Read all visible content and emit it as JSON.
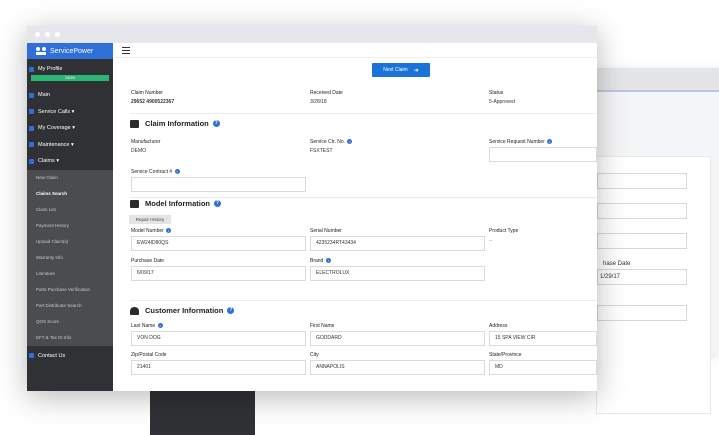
{
  "app": {
    "brand": "ServicePower"
  },
  "sidebar": {
    "items": [
      {
        "label": "My Profile"
      },
      {
        "label": "Main"
      },
      {
        "label": "Service Calls ▾"
      },
      {
        "label": "My Coverage ▾"
      },
      {
        "label": "Maintenance ▾"
      },
      {
        "label": "Claims ▾"
      }
    ],
    "profile_progress": "100%",
    "claims_submenu": [
      "New Claim",
      "Claims Search",
      "Claim List",
      "Payment History",
      "Upload Claim(s)",
      "Warranty Info",
      "Literature",
      "Parts Purchase Verification",
      "Part Distributor Search",
      "QOS Score",
      "EFT & Tax ID Info"
    ],
    "contact": "Contact Us"
  },
  "toolbar": {
    "next_claim_label": "Next Claim",
    "next_arrow": "➜"
  },
  "claim": {
    "number_label": "Claim Number",
    "number_value": "29652 4900522367",
    "received_label": "Received Date",
    "received_value": "3/28/18",
    "status_label": "Status",
    "status_value": "5-Approved"
  },
  "claim_info": {
    "title": "Claim Information",
    "manufacturer_label": "Manufacturer",
    "manufacturer_value": "DEMO",
    "service_ctr_label": "Service Ctr. No.",
    "service_ctr_value": "FSXTEST",
    "service_request_label": "Service Request Number",
    "service_contract_label": "Service Contract #"
  },
  "model_info": {
    "title": "Model Information",
    "repair_history_button": "Repair History",
    "model_label": "Model Number",
    "model_value": "EW24ID80QS",
    "serial_label": "Serial Number",
    "serial_value": "4235234RT43434",
    "product_type_label": "Product Type",
    "product_type_value": "--",
    "purchase_date_label": "Purchase Date",
    "purchase_date_value": "6/09/17",
    "brand_label": "Brand",
    "brand_value": "ELECTROLUX"
  },
  "customer_info": {
    "title": "Customer Information",
    "last_name_label": "Last Name",
    "last_name_value": "VON DOG",
    "first_name_label": "First Name",
    "first_name_value": "GODDARD",
    "address_label": "Address",
    "address_value": "15 SPA VIEW CIR",
    "zip_label": "Zip/Postal Code",
    "zip_value": "21401",
    "city_label": "City",
    "city_value": "ANNAPOLIS",
    "state_label": "State/Province",
    "state_value": "MD"
  },
  "background_window": {
    "purchase_date_label_fragment": "hase Date",
    "purchase_date_value_fragment": "1/29/17"
  },
  "colors": {
    "brand_blue": "#2e6fd8",
    "sidebar_dark": "#2f3134",
    "progress_green": "#2bb673",
    "button_blue": "#1a73d9"
  }
}
